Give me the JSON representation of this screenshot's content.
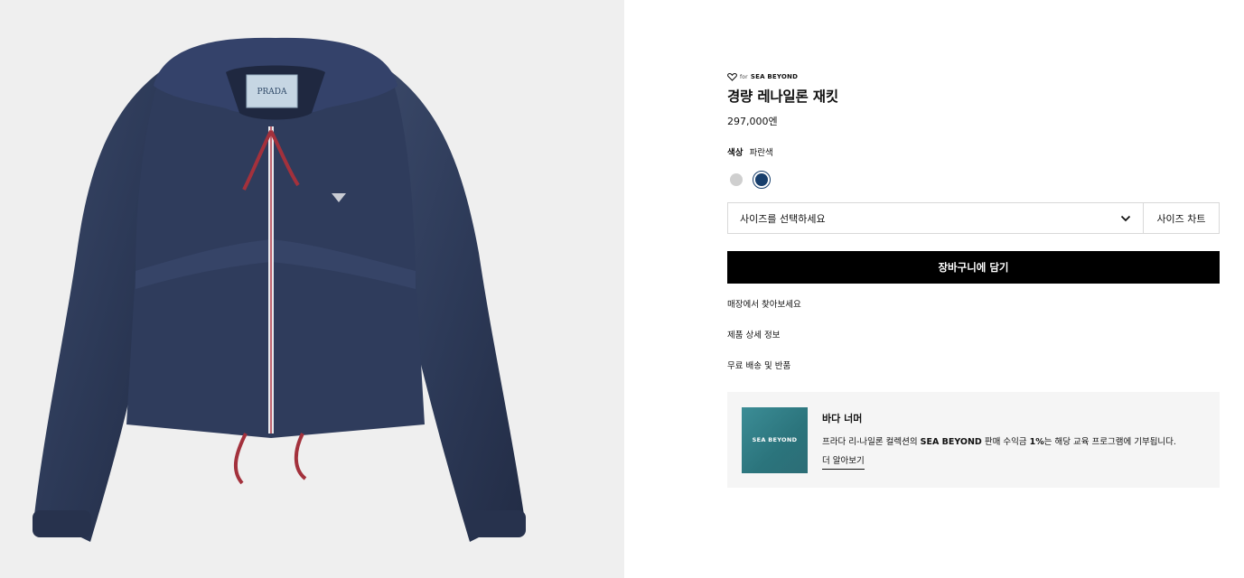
{
  "product": {
    "brand_for": "for",
    "brand_program": "SEA BEYOND",
    "title": "경량 레나일론 재킷",
    "price": "297,000엔",
    "label_text": "PRADA"
  },
  "color": {
    "label": "색상",
    "selected": "파란색",
    "swatches": [
      {
        "name": "grey",
        "hex": "#cfcfcf"
      },
      {
        "name": "blue",
        "hex": "#173e6c"
      }
    ]
  },
  "size": {
    "placeholder": "사이즈를 선택하세요",
    "chart_label": "사이즈 차트"
  },
  "actions": {
    "add_to_cart": "장바구니에 담기"
  },
  "links": [
    "매장에서 찾아보세요",
    "제품 상세 정보",
    "무료 배송 및 반품"
  ],
  "promo": {
    "image_text": "SEA BEYOND",
    "title": "바다 너머",
    "desc_prefix": "프라다 리-나일론 컬렉션의 ",
    "desc_bold1": "SEA BEYOND",
    "desc_mid": " 판매 수익금 ",
    "desc_bold2": "1%",
    "desc_suffix": "는 해당 교육 프로그램에 기부됩니다.",
    "link": "더 알아보기"
  }
}
